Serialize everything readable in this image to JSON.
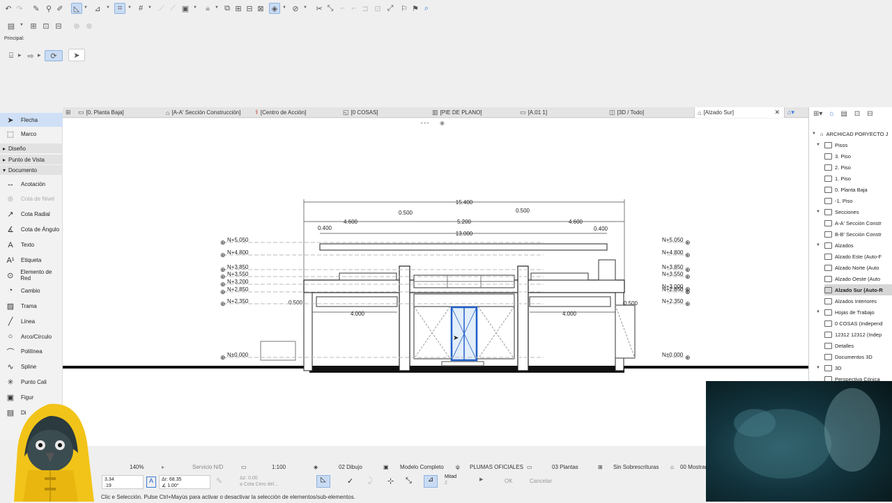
{
  "principal_label": "Principal:",
  "tabs": [
    {
      "label": "[0. Planta Baja]",
      "icon": "floorplan-icon"
    },
    {
      "label": "[A-A' Sección Construcción]",
      "icon": "section-icon"
    },
    {
      "label": "[Centro de Acción]",
      "icon": "action-center-icon"
    },
    {
      "label": "[0 COSAS]",
      "icon": "worksheet-icon"
    },
    {
      "label": "[PIE DE PLANO]",
      "icon": "layout-icon"
    },
    {
      "label": "[A.01 1]",
      "icon": "layout-icon"
    },
    {
      "label": "[3D / Todo]",
      "icon": "3d-icon"
    },
    {
      "label": "[Alzado Sur]",
      "icon": "elevation-icon"
    }
  ],
  "toolbox": {
    "top_tools": [
      {
        "label": "Flecha",
        "icon": "arrow-icon"
      },
      {
        "label": "Marco",
        "icon": "marquee-icon"
      }
    ],
    "sections": [
      "Diseño",
      "Punto de Vista",
      "Documento"
    ],
    "doc_tools": [
      {
        "label": "Acotación",
        "icon": "dimension-icon"
      },
      {
        "label": "Cota de Nivel",
        "icon": "level-dimension-icon"
      },
      {
        "label": "Cota Radial",
        "icon": "radial-dimension-icon"
      },
      {
        "label": "Cota de Ángulo",
        "icon": "angle-dimension-icon"
      },
      {
        "label": "Texto",
        "icon": "text-icon"
      },
      {
        "label": "Etiqueta",
        "icon": "label-icon"
      },
      {
        "label": "Elemento de Red",
        "icon": "grid-element-icon"
      },
      {
        "label": "Cambio",
        "icon": "change-icon"
      },
      {
        "label": "Trama",
        "icon": "fill-icon"
      },
      {
        "label": "Línea",
        "icon": "line-icon"
      },
      {
        "label": "Arco/Círculo",
        "icon": "arc-icon"
      },
      {
        "label": "Polilínea",
        "icon": "polyline-icon"
      },
      {
        "label": "Spline",
        "icon": "spline-icon"
      },
      {
        "label": "Punto Cali",
        "icon": "hotspot-icon"
      },
      {
        "label": "Figur",
        "icon": "figure-icon"
      },
      {
        "label": "Di",
        "icon": "drawing-icon"
      }
    ]
  },
  "navigator": {
    "root": "ARCHICAD PORYECTO J",
    "items": [
      {
        "label": "Pisos",
        "level": 1,
        "expanded": true
      },
      {
        "label": "3. Piso",
        "level": 2
      },
      {
        "label": "2. Piso",
        "level": 2
      },
      {
        "label": "1. Piso",
        "level": 2
      },
      {
        "label": "0. Planta Baja",
        "level": 2
      },
      {
        "label": "-1. Piso",
        "level": 2
      },
      {
        "label": "Secciones",
        "level": 1,
        "expanded": true
      },
      {
        "label": "A-A' Sección Constr",
        "level": 2
      },
      {
        "label": "B-B' Sección Constr",
        "level": 2
      },
      {
        "label": "Alzados",
        "level": 1,
        "expanded": true
      },
      {
        "label": "Alzado Este (Auto-F",
        "level": 2
      },
      {
        "label": "Alzado Norte (Auto",
        "level": 2
      },
      {
        "label": "Alzado Oeste (Auto",
        "level": 2
      },
      {
        "label": "Alzado Sur (Auto-R",
        "level": 2,
        "selected": true
      },
      {
        "label": "Alzados Interiores",
        "level": 1
      },
      {
        "label": "Hojas de Trabajo",
        "level": 1,
        "expanded": true
      },
      {
        "label": "0 COSAS (Independ",
        "level": 2
      },
      {
        "label": "12312 12312 (Indep",
        "level": 2
      },
      {
        "label": "Detalles",
        "level": 1
      },
      {
        "label": "Documentos 3D",
        "level": 1
      },
      {
        "label": "3D",
        "level": 1,
        "expanded": true
      },
      {
        "label": "Perspectiva Cónica",
        "level": 2
      }
    ]
  },
  "drawing": {
    "dims": {
      "overall": "15.400",
      "seg_a": "4.600",
      "seg_b": "0.500",
      "seg_c": "5.200",
      "seg_d": "0.500",
      "seg_e": "4.600",
      "inner": "13.000",
      "side_l": "0.400",
      "side_r": "0.400",
      "win_l": "4.000",
      "win_r": "4.000",
      "small_l": "0.500",
      "small_r": "0.500"
    },
    "levels_left": [
      "N+5.050",
      "N+4.800",
      "N+3.850",
      "N+3.550",
      "N+3.200",
      "N+2.850",
      "N+2.350",
      "N±0.000"
    ],
    "levels_right": [
      "N+5.050",
      "N+4.800",
      "N+3.850",
      "N+3.550",
      "N+3.000",
      "N+2.850",
      "N+2.350",
      "N±0.000"
    ]
  },
  "statusbar": {
    "zoom": "140%",
    "service": "Servicio N/D",
    "scale": "1:100",
    "layer_combo": "02 Dibujo",
    "model": "Modelo Completo",
    "pens": "PLUMAS OFICIALES",
    "plants": "03 Plantas",
    "overrides": "Sin Sobrescrituras",
    "show": "00 Mostrar"
  },
  "infobar": {
    "coord_x": "3.34",
    "coord_y": ".19",
    "dr_label": "Δr: 68.35",
    "angle": "∡ 1.00°",
    "dz": "Δz: 0.00",
    "zero": "a Cota Cero del...",
    "mitad": "Mitad",
    "mitad_n": "2",
    "ok": "OK",
    "cancel": "Cancelar"
  },
  "hint": "Clic e      Selección. Pulse Ctrl+Mayús para activar o desactivar la selección de elementos/sub-elementos."
}
